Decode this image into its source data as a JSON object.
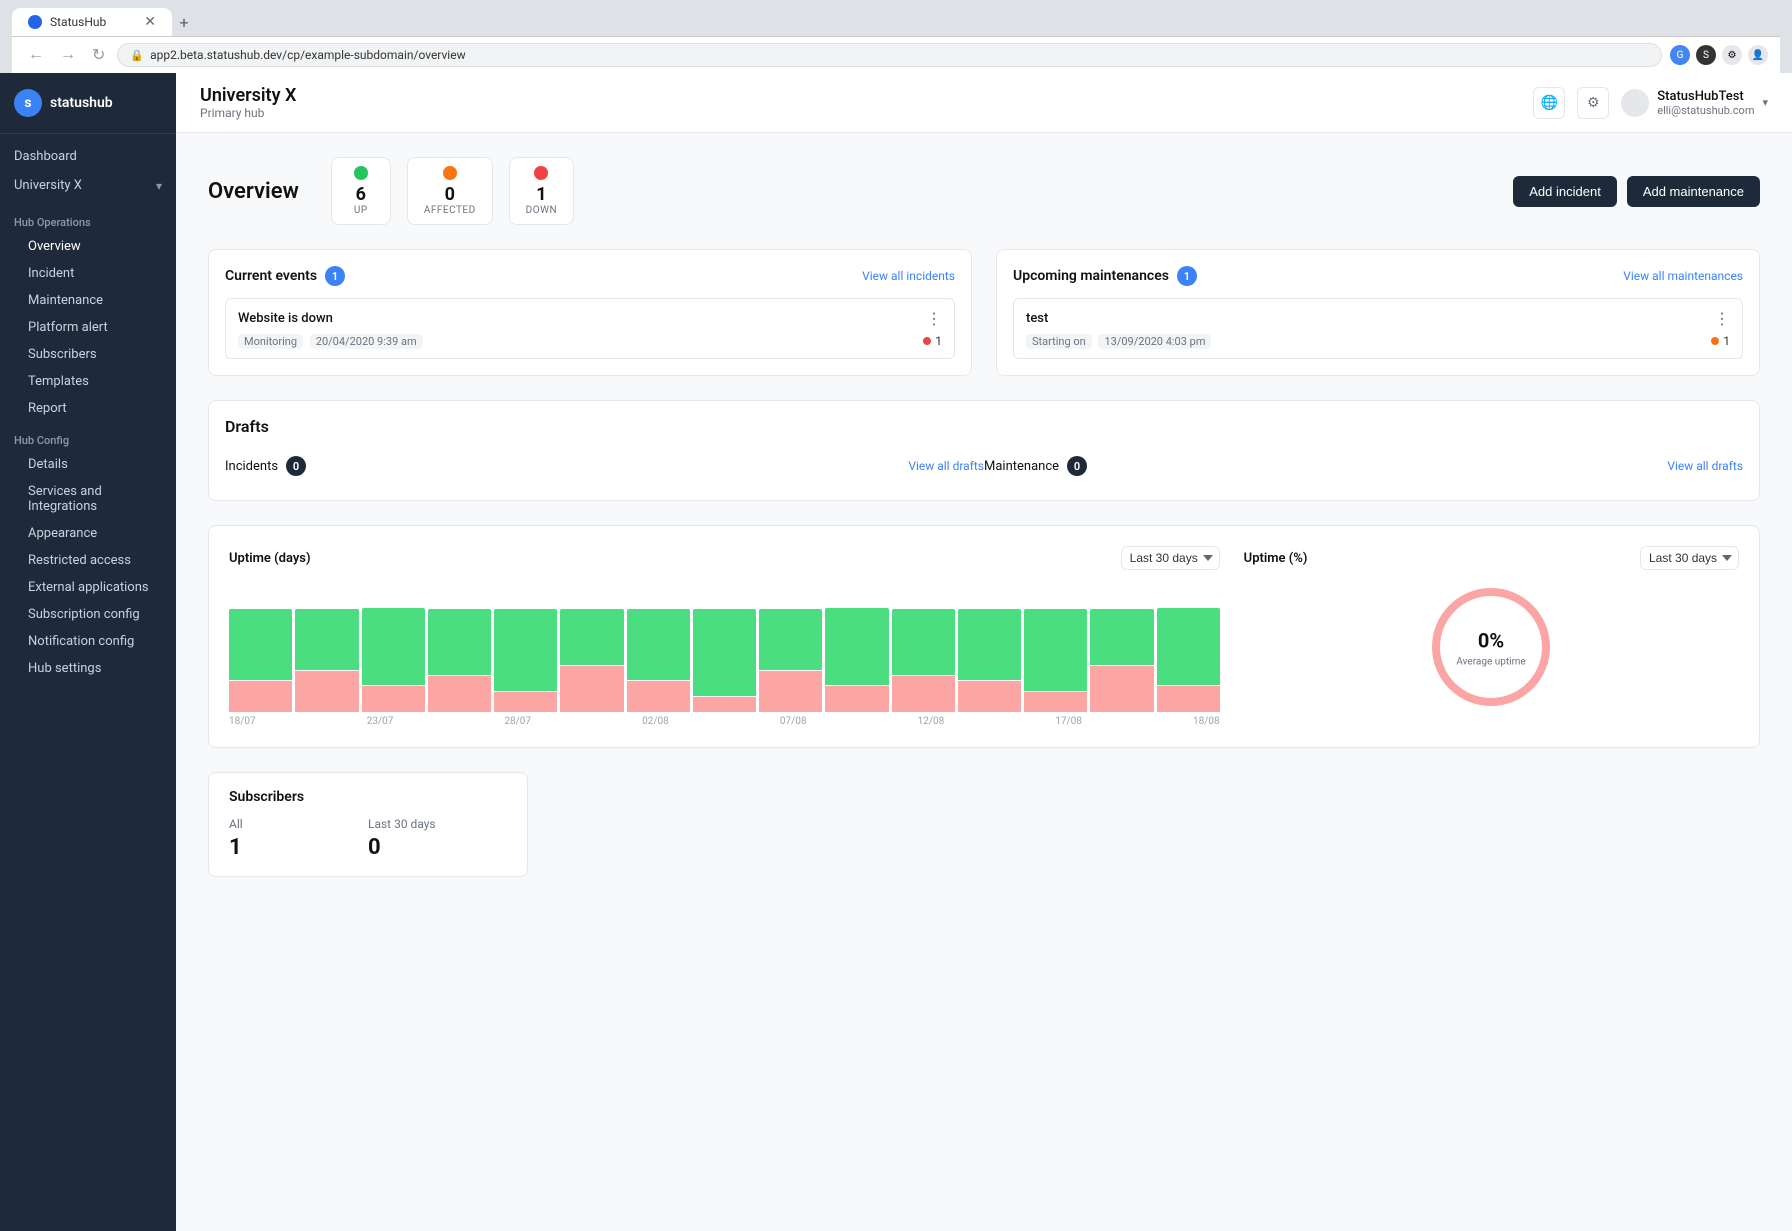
{
  "browser": {
    "tab_title": "StatusHub",
    "url": "app2.beta.statushub.dev/cp/example-subdomain/overview",
    "new_tab_label": "+"
  },
  "sidebar": {
    "logo_text": "statushub",
    "dashboard_label": "Dashboard",
    "university_x_label": "University X",
    "hub_operations_label": "Hub Operations",
    "nav_items": [
      {
        "label": "Overview",
        "active": true
      },
      {
        "label": "Incident",
        "active": false
      },
      {
        "label": "Maintenance",
        "active": false
      },
      {
        "label": "Platform alert",
        "active": false
      },
      {
        "label": "Subscribers",
        "active": false
      },
      {
        "label": "Templates",
        "active": false
      },
      {
        "label": "Report",
        "active": false
      }
    ],
    "hub_config_label": "Hub Config",
    "config_items": [
      {
        "label": "Details"
      },
      {
        "label": "Services and Integrations"
      },
      {
        "label": "Appearance"
      },
      {
        "label": "Restricted access"
      },
      {
        "label": "External applications"
      },
      {
        "label": "Subscription config"
      },
      {
        "label": "Notification config"
      },
      {
        "label": "Hub settings"
      }
    ]
  },
  "topbar": {
    "title": "University X",
    "subtitle": "Primary hub",
    "user_name": "StatusHubTest",
    "user_email": "elli@statushub.com"
  },
  "overview": {
    "title": "Overview",
    "status": {
      "up_count": "6",
      "up_label": "UP",
      "affected_count": "0",
      "affected_label": "AFFECTED",
      "down_count": "1",
      "down_label": "DOWN"
    },
    "add_incident_label": "Add incident",
    "add_maintenance_label": "Add maintenance"
  },
  "current_events": {
    "title": "Current events",
    "badge": "1",
    "view_all_label": "View all incidents",
    "event": {
      "title": "Website is down",
      "tag_label": "Monitoring",
      "tag_value": "20/04/2020 9:39 am",
      "count": "1"
    }
  },
  "upcoming_maintenances": {
    "title": "Upcoming maintenances",
    "badge": "1",
    "view_all_label": "View all maintenances",
    "event": {
      "title": "test",
      "starting_label": "Starting on",
      "starting_value": "13/09/2020 4:03 pm",
      "count": "1"
    }
  },
  "drafts": {
    "title": "Drafts",
    "incidents_label": "Incidents",
    "incidents_count": "0",
    "incidents_view_all": "View all drafts",
    "maintenance_label": "Maintenance",
    "maintenance_count": "0",
    "maintenance_view_all": "View all drafts"
  },
  "uptime_days": {
    "title": "Uptime (days)",
    "period_label": "Last 30 days",
    "bar_labels": [
      "18/07",
      "23/07",
      "28/07",
      "02/08",
      "07/08",
      "12/08",
      "17/08",
      "18/08"
    ],
    "bars": [
      {
        "green": 70,
        "red": 30
      },
      {
        "green": 60,
        "red": 40
      },
      {
        "green": 75,
        "red": 25
      },
      {
        "green": 65,
        "red": 35
      },
      {
        "green": 80,
        "red": 20
      },
      {
        "green": 55,
        "red": 45
      },
      {
        "green": 70,
        "red": 30
      },
      {
        "green": 85,
        "red": 15
      },
      {
        "green": 60,
        "red": 40
      },
      {
        "green": 75,
        "red": 25
      },
      {
        "green": 65,
        "red": 35
      },
      {
        "green": 70,
        "red": 30
      },
      {
        "green": 80,
        "red": 20
      },
      {
        "green": 55,
        "red": 45
      },
      {
        "green": 75,
        "red": 25
      }
    ]
  },
  "uptime_pct": {
    "title": "Uptime (%)",
    "period_label": "Last 30 days",
    "percentage": "0%",
    "avg_label": "Average uptime"
  },
  "subscribers": {
    "title": "Subscribers",
    "all_label": "All",
    "all_value": "1",
    "last30_label": "Last 30 days",
    "last30_value": "0"
  }
}
